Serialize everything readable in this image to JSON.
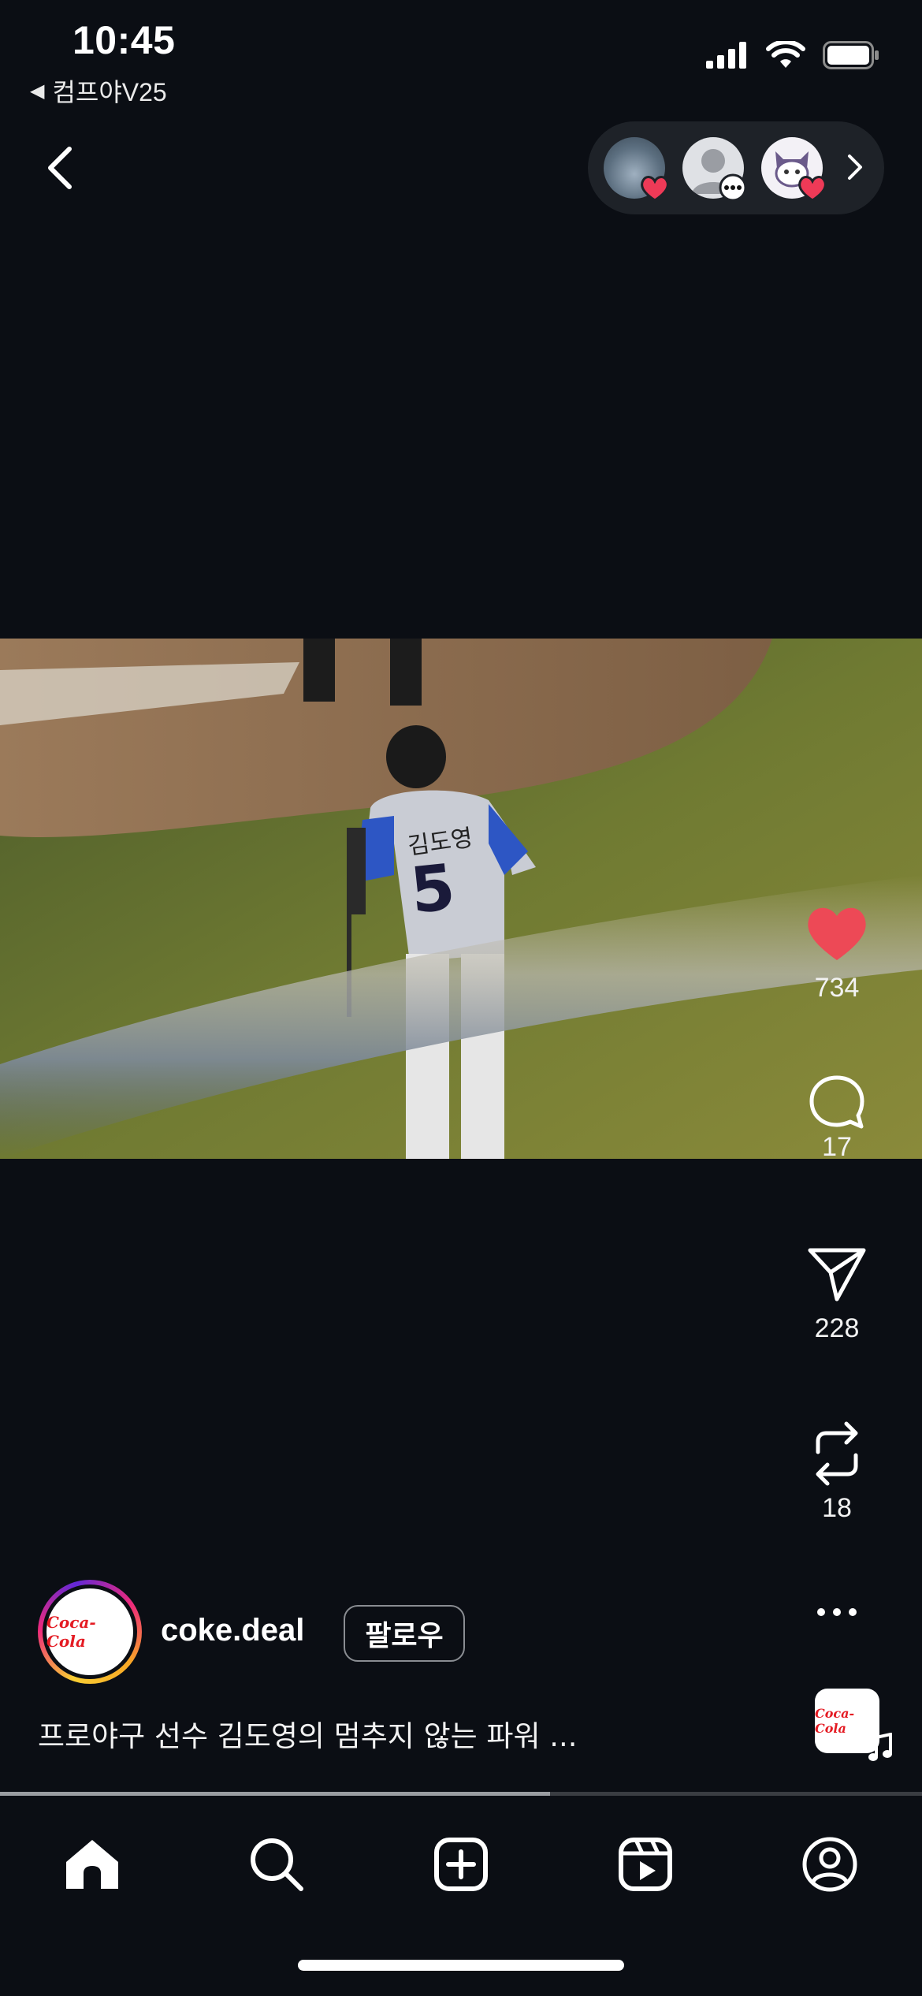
{
  "status_bar": {
    "time": "10:45",
    "back_to_app": "컴프야V25",
    "icons": [
      "cellular-signal-icon",
      "wifi-icon",
      "battery-icon"
    ]
  },
  "top_nav": {
    "back_icon": "chevron-left-icon",
    "friends_activity": {
      "avatars": [
        {
          "name": "friend-avatar-1",
          "badge": "heart-icon"
        },
        {
          "name": "friend-avatar-2",
          "badge": "comment-bubble-icon"
        },
        {
          "name": "friend-avatar-3",
          "badge": "heart-icon"
        }
      ],
      "more_icon": "chevron-right-icon"
    }
  },
  "actions": {
    "like_count": "734",
    "comment_count": "17",
    "share_count": "228",
    "repost_count": "18",
    "like_color": "#ed4956"
  },
  "post": {
    "username": "coke.deal",
    "follow_label": "팔로우",
    "caption": "프로야구 선수 김도영의 멈추지 않는 파워 ...",
    "avatar_logo_text": "Coca-Cola"
  },
  "video": {
    "jersey_name": "김도영",
    "jersey_number": "5",
    "progress": 0.597
  },
  "tab_bar": {
    "tabs": [
      "home-icon",
      "search-icon",
      "create-post-icon",
      "reels-icon",
      "profile-icon"
    ]
  }
}
